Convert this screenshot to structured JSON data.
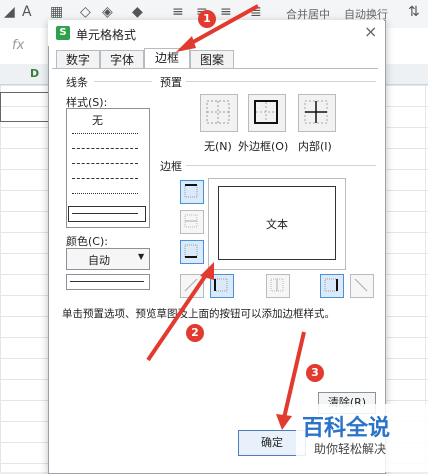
{
  "toolbar": {
    "merge_center": "合并居中",
    "auto_wrap": "自动换行"
  },
  "sheet": {
    "fx": "fx",
    "column_d": "D"
  },
  "dialog": {
    "app_icon": "S",
    "title": "单元格格式",
    "close": "×",
    "tabs": [
      {
        "label": "数字"
      },
      {
        "label": "字体"
      },
      {
        "label": "边框"
      },
      {
        "label": "图案"
      }
    ],
    "line_group": "线条",
    "style_label": "样式(S):",
    "style_none": "无",
    "color_label": "颜色(C):",
    "color_value": "自动",
    "preset_group": "预置",
    "presets": [
      {
        "label": "无(N)",
        "icon": "border-none-icon"
      },
      {
        "label": "外边框(O)",
        "icon": "border-outline-icon"
      },
      {
        "label": "内部(I)",
        "icon": "border-inside-icon"
      }
    ],
    "border_group": "边框",
    "preview_text": "文本",
    "hint": "单击预置选项、预览草图及上面的按钮可以添加边框样式。",
    "clear_button": "清除(R)",
    "ok_button": "确定"
  },
  "annotations": {
    "step1": "1",
    "step2": "2",
    "step3": "3"
  },
  "watermark": {
    "title": "百科全说",
    "subtitle": "助你轻松解决"
  },
  "colors": {
    "accent": "#4a90d9",
    "arrow": "#e23a2e",
    "watermark": "#2a73c9"
  }
}
